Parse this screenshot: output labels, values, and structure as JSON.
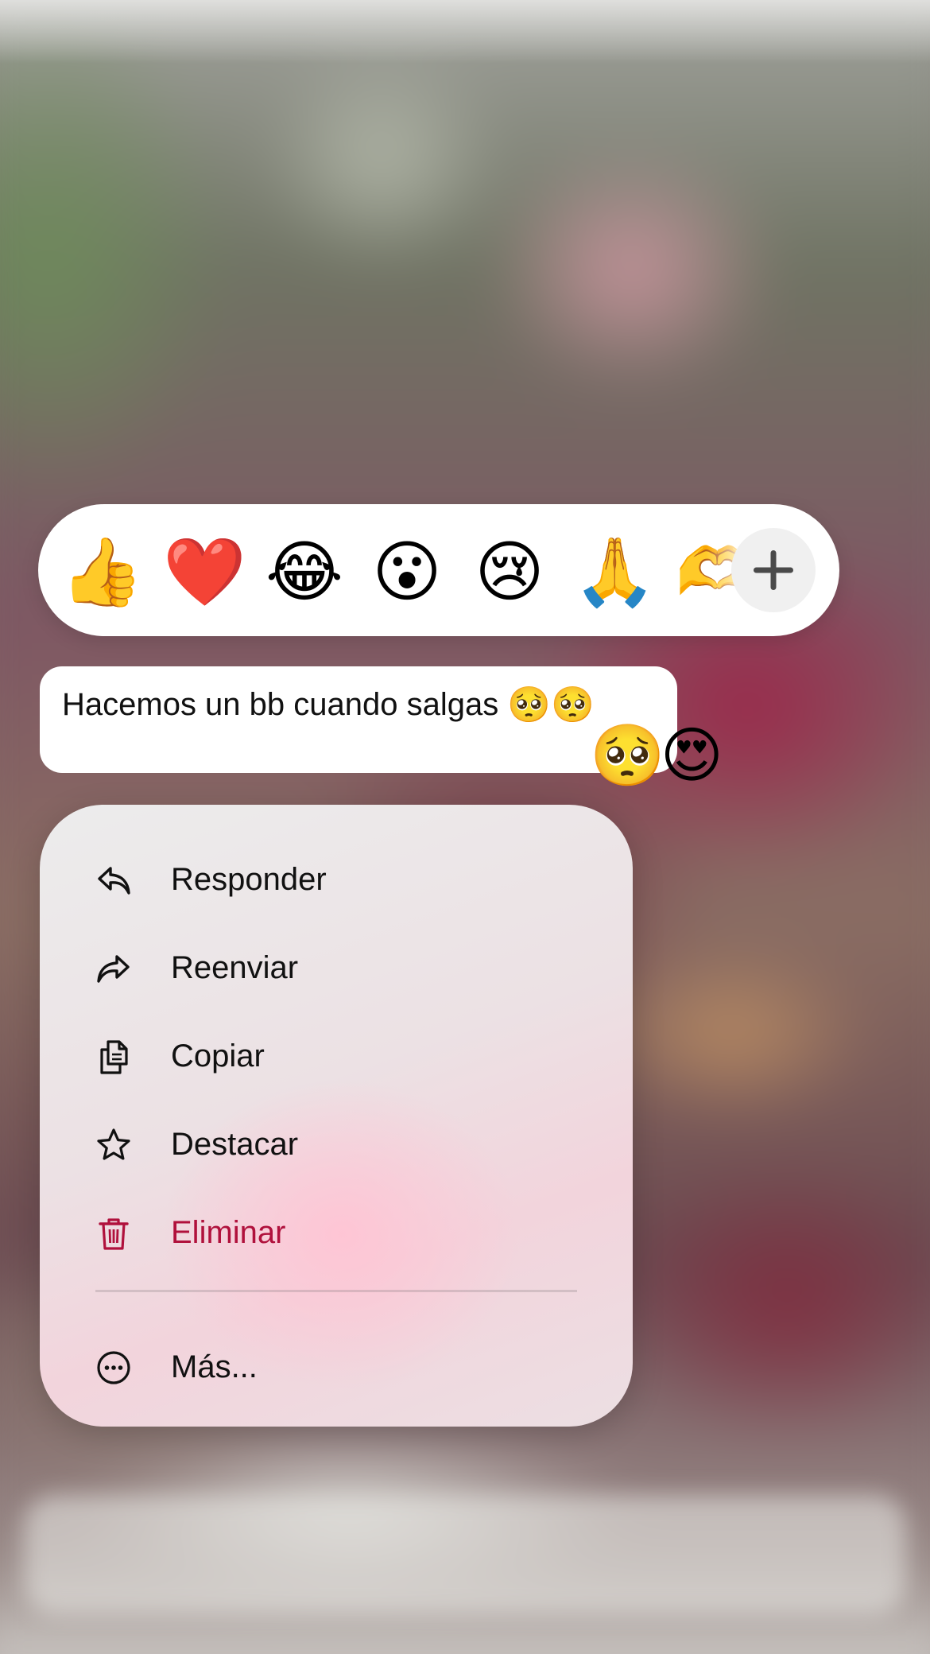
{
  "reactions": [
    {
      "emoji": "👍",
      "name": "thumbs-up"
    },
    {
      "emoji": "❤️",
      "name": "red-heart"
    },
    {
      "emoji": "😂",
      "name": "tears-of-joy"
    },
    {
      "emoji": "😮",
      "name": "surprised"
    },
    {
      "emoji": "😢",
      "name": "crying"
    },
    {
      "emoji": "🙏",
      "name": "folded-hands"
    },
    {
      "emoji": "🫶",
      "name": "heart-hands-partial"
    }
  ],
  "more_reactions_icon": "plus-icon",
  "message": {
    "text": "Hacemos un bb cuando salgas",
    "inline_emojis": "🥺🥺",
    "reactions": "🥺😍"
  },
  "menu": {
    "items": [
      {
        "label": "Responder",
        "icon": "reply-icon"
      },
      {
        "label": "Reenviar",
        "icon": "forward-icon"
      },
      {
        "label": "Copiar",
        "icon": "copy-icon"
      },
      {
        "label": "Destacar",
        "icon": "star-icon"
      },
      {
        "label": "Eliminar",
        "icon": "trash-icon",
        "color": "#b0113c"
      }
    ],
    "more": {
      "label": "Más...",
      "icon": "more-circle-icon"
    }
  }
}
